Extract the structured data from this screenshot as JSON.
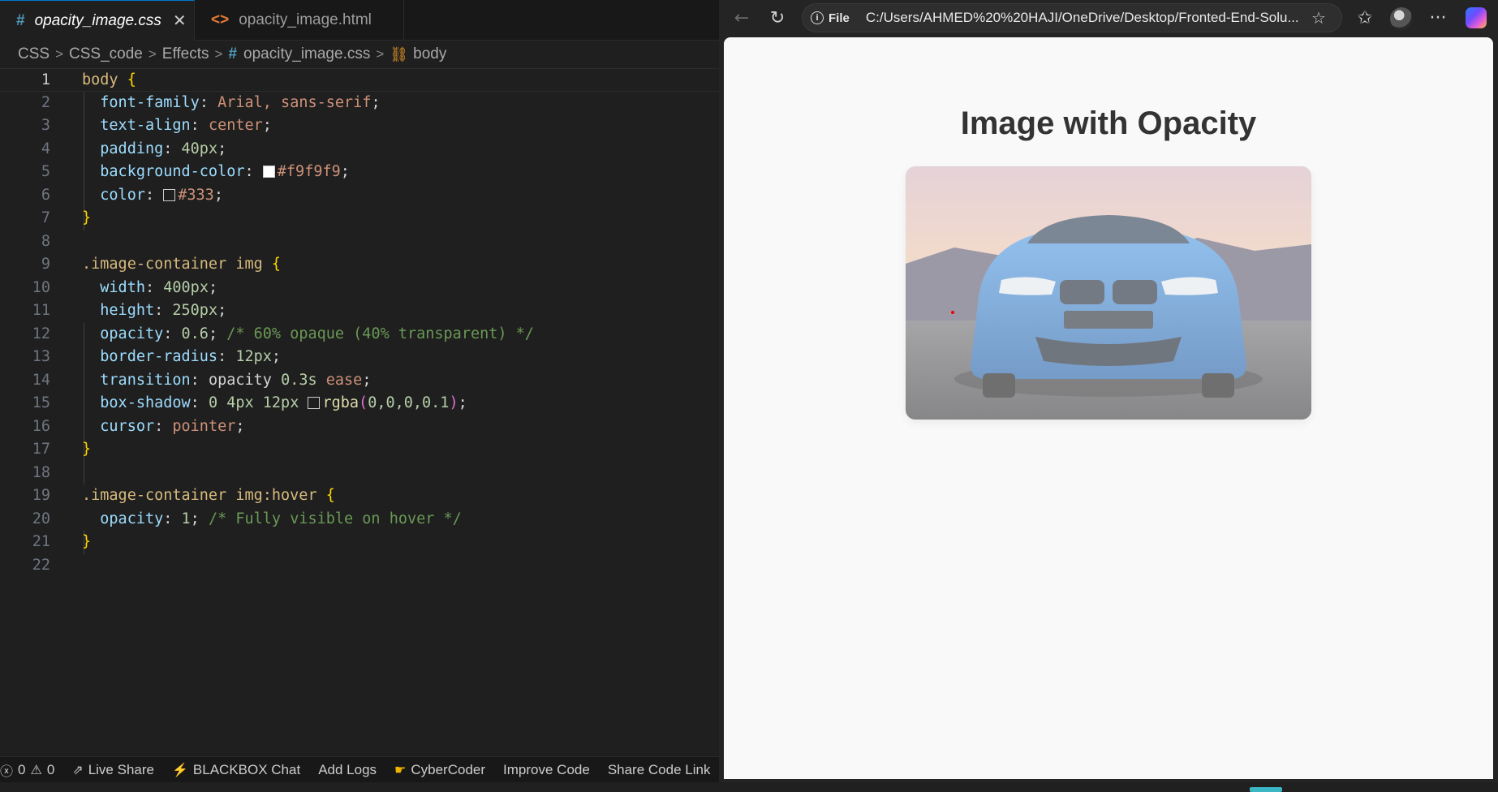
{
  "editor": {
    "tabs": [
      {
        "label": "opacity_image.css",
        "icon": "#",
        "active": true,
        "close": "✕"
      },
      {
        "label": "opacity_image.html",
        "icon": "<>",
        "active": false
      }
    ],
    "breadcrumb": [
      "CSS",
      "CSS_code",
      "Effects",
      "opacity_image.css",
      "body"
    ],
    "lines": [
      "1",
      "2",
      "3",
      "4",
      "5",
      "6",
      "7",
      "8",
      "9",
      "10",
      "11",
      "12",
      "13",
      "14",
      "15",
      "16",
      "17",
      "18",
      "19",
      "20",
      "21",
      "22"
    ],
    "code": {
      "l1_sel": "body",
      "l2_prop": "font-family",
      "l2_val": "Arial, sans-serif",
      "l3_prop": "text-align",
      "l3_val": "center",
      "l4_prop": "padding",
      "l4_val": "40px",
      "l5_prop": "background-color",
      "l5_val": "#f9f9f9",
      "l6_prop": "color",
      "l6_val": "#333",
      "l9_sel": ".image-container img",
      "l10_prop": "width",
      "l10_val": "400px",
      "l11_prop": "height",
      "l11_val": "250px",
      "l12_prop": "opacity",
      "l12_val": "0.6",
      "l12_cmt": "/* 60% opaque (40% transparent) */",
      "l13_prop": "border-radius",
      "l13_val": "12px",
      "l14_prop": "transition",
      "l14_v1": "opacity",
      "l14_v2": "0.3s",
      "l14_v3": "ease",
      "l15_prop": "box-shadow",
      "l15_v1": "0 4px 12px",
      "l15_fn": "rgba",
      "l15_args": "0,0,0,0.1",
      "l16_prop": "cursor",
      "l16_val": "pointer",
      "l19_sel": ".image-container img:hover",
      "l20_prop": "opacity",
      "l20_val": "1",
      "l20_cmt": "/* Fully visible on hover */"
    },
    "swatches": {
      "l5": "#ffffff",
      "l6": "#1f1f1f",
      "l15": "#1f1f1f"
    }
  },
  "statusbar": {
    "errors": "0",
    "warnings": "0",
    "items": [
      "Live Share",
      "BLACKBOX Chat",
      "Add Logs",
      "CyberCoder",
      "Improve Code",
      "Share Code Link"
    ]
  },
  "browser": {
    "file_label": "File",
    "url": "C:/Users/AHMED%20%20HAJI/OneDrive/Desktop/Fronted-End-Solu...",
    "page_heading": "Image with Opacity",
    "image_opacity": 0.6
  },
  "colors": {
    "accent": "#0078d4",
    "page_bg": "#f9f9f9",
    "text": "#333333"
  }
}
